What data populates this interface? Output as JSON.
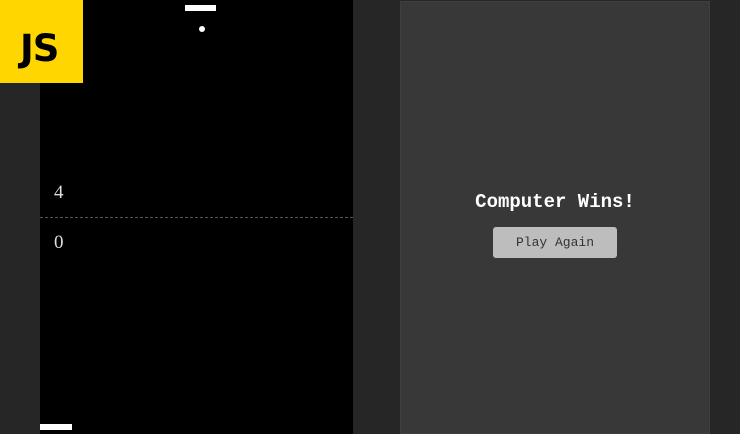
{
  "badge": {
    "text": "JS",
    "color": "#ffd600"
  },
  "game": {
    "score_top": "4",
    "score_bottom": "0"
  },
  "overlay": {
    "title": "Computer Wins!",
    "button_label": "Play Again"
  },
  "colors": {
    "background": "#262626",
    "canvas": "#000000",
    "panel": "#383838",
    "button": "#bdbdbd"
  }
}
